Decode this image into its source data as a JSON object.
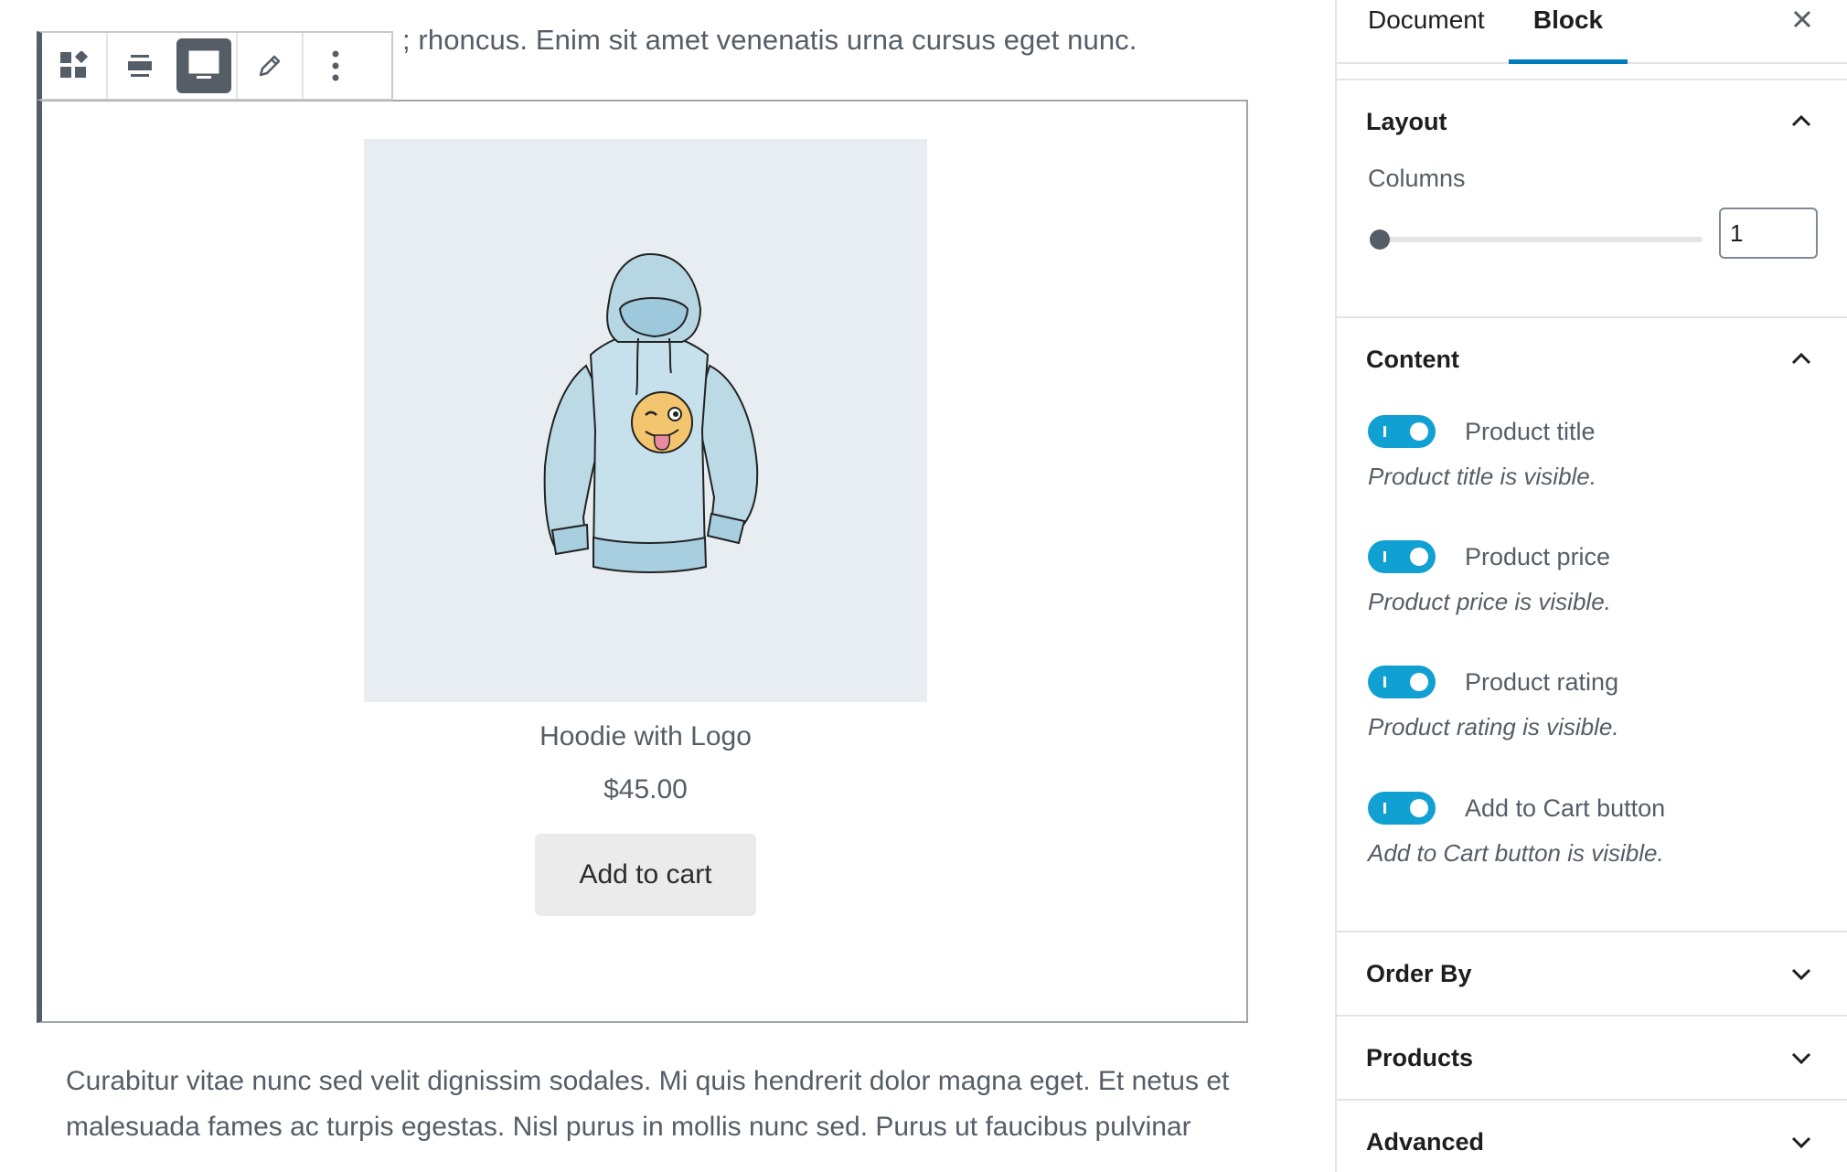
{
  "editor": {
    "paragraph_top": "; rhoncus. Enim sit amet venenatis urna cursus eget nunc.",
    "paragraph_bottom": "Curabitur vitae nunc sed velit dignissim sodales. Mi quis hendrerit dolor magna eget. Et netus et malesuada fames ac turpis egestas. Nisl purus in mollis nunc sed. Purus ut faucibus pulvinar",
    "toolbar": {
      "icons": [
        "block-type-icon",
        "align-wide-icon",
        "align-full-icon",
        "edit-pencil-icon",
        "more-options-icon"
      ]
    },
    "product": {
      "title": "Hoodie with Logo",
      "price": "$45.00",
      "button_label": "Add to cart"
    }
  },
  "sidebar": {
    "tabs": [
      {
        "label": "Document",
        "active": false
      },
      {
        "label": "Block",
        "active": true
      }
    ],
    "layout": {
      "title": "Layout",
      "columns_label": "Columns",
      "columns_value": "1"
    },
    "content": {
      "title": "Content",
      "toggles": [
        {
          "label": "Product title",
          "help": "Product title is visible.",
          "on": true
        },
        {
          "label": "Product price",
          "help": "Product price is visible.",
          "on": true
        },
        {
          "label": "Product rating",
          "help": "Product rating is visible.",
          "on": true
        },
        {
          "label": "Add to Cart button",
          "help": "Add to Cart button is visible.",
          "on": true
        }
      ]
    },
    "order_by": {
      "title": "Order By"
    },
    "products": {
      "title": "Products"
    },
    "advanced": {
      "title": "Advanced"
    }
  },
  "colors": {
    "accent": "#007cba",
    "toggle_on": "#11a0d2",
    "dark": "#555d66"
  }
}
